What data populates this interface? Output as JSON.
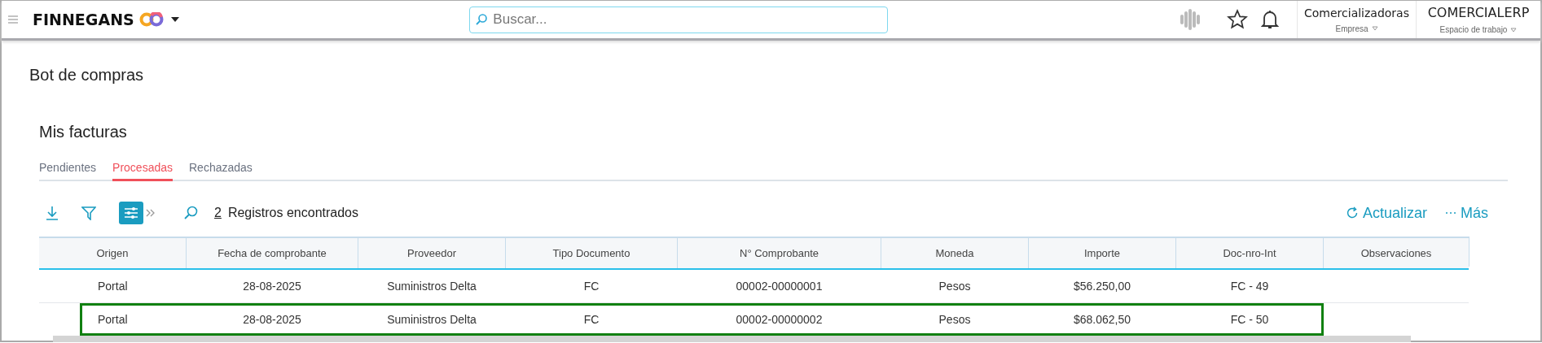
{
  "topbar": {
    "brand": "FINNEGANS",
    "search": {
      "placeholder": "Buscar..."
    },
    "company": {
      "value": "Comercializadoras",
      "label": "Empresa"
    },
    "workspace": {
      "value": "COMERCIALERP",
      "label": "Espacio de trabajo"
    }
  },
  "page_title": "Bot de compras",
  "section_title": "Mis facturas",
  "tabs": [
    {
      "label": "Pendientes",
      "selected": false
    },
    {
      "label": "Procesadas",
      "selected": true
    },
    {
      "label": "Rechazadas",
      "selected": false
    }
  ],
  "toolbar": {
    "count": "2",
    "count_label": "Registros encontrados",
    "refresh": "Actualizar",
    "more": "Más"
  },
  "table": {
    "columns": [
      "Origen",
      "Fecha de comprobante",
      "Proveedor",
      "Tipo Documento",
      "N° Comprobante",
      "Moneda",
      "Importe",
      "Doc-nro-Int",
      "Observaciones"
    ],
    "rows": [
      {
        "cells": [
          "Portal",
          "28-08-2025",
          "Suministros Delta",
          "FC",
          "00002-00000001",
          "Pesos",
          "$56.250,00",
          "FC - 49",
          ""
        ],
        "highlighted": false
      },
      {
        "cells": [
          "Portal",
          "28-08-2025",
          "Suministros Delta",
          "FC",
          "00002-00000002",
          "Pesos",
          "$68.062,50",
          "FC - 50",
          ""
        ],
        "highlighted": true
      }
    ]
  }
}
